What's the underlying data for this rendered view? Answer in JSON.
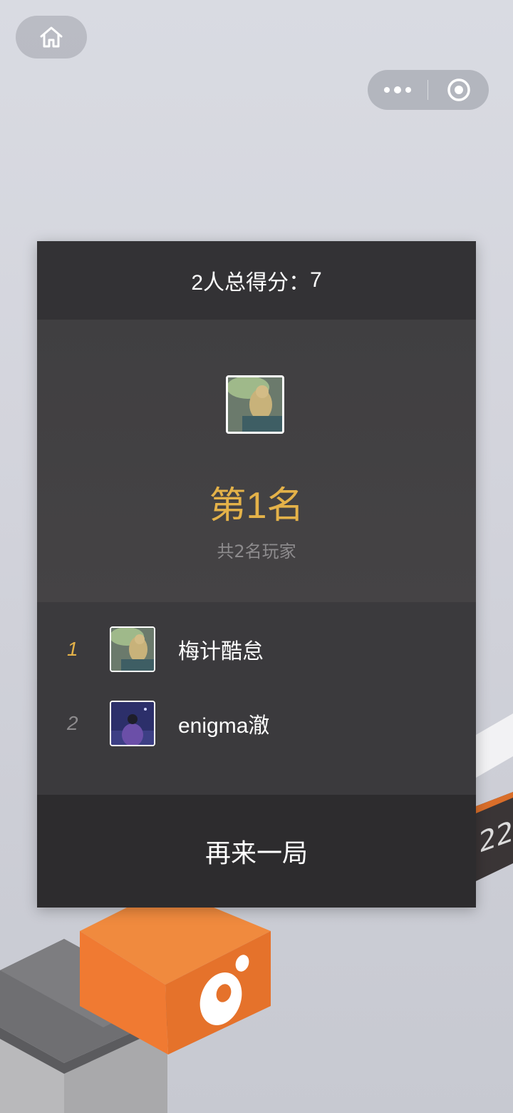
{
  "nav": {
    "home_icon": "home-icon",
    "more_icon": "more-dots-icon",
    "close_icon": "target-close-icon"
  },
  "modal": {
    "total_score_label": "2人总得分：",
    "total_score_value": "7",
    "rank_title": "第1名",
    "players_count": "共2名玩家",
    "again_button": "再来一局"
  },
  "leaderboard": [
    {
      "rank": "1",
      "name": "梅计酷怠",
      "rank_color": "#e4b249"
    },
    {
      "rank": "2",
      "name": "enigma澈",
      "rank_color": "#8d8b8d"
    }
  ],
  "colors": {
    "accent_gold": "#e4b249",
    "block_orange": "#ef7b33"
  }
}
